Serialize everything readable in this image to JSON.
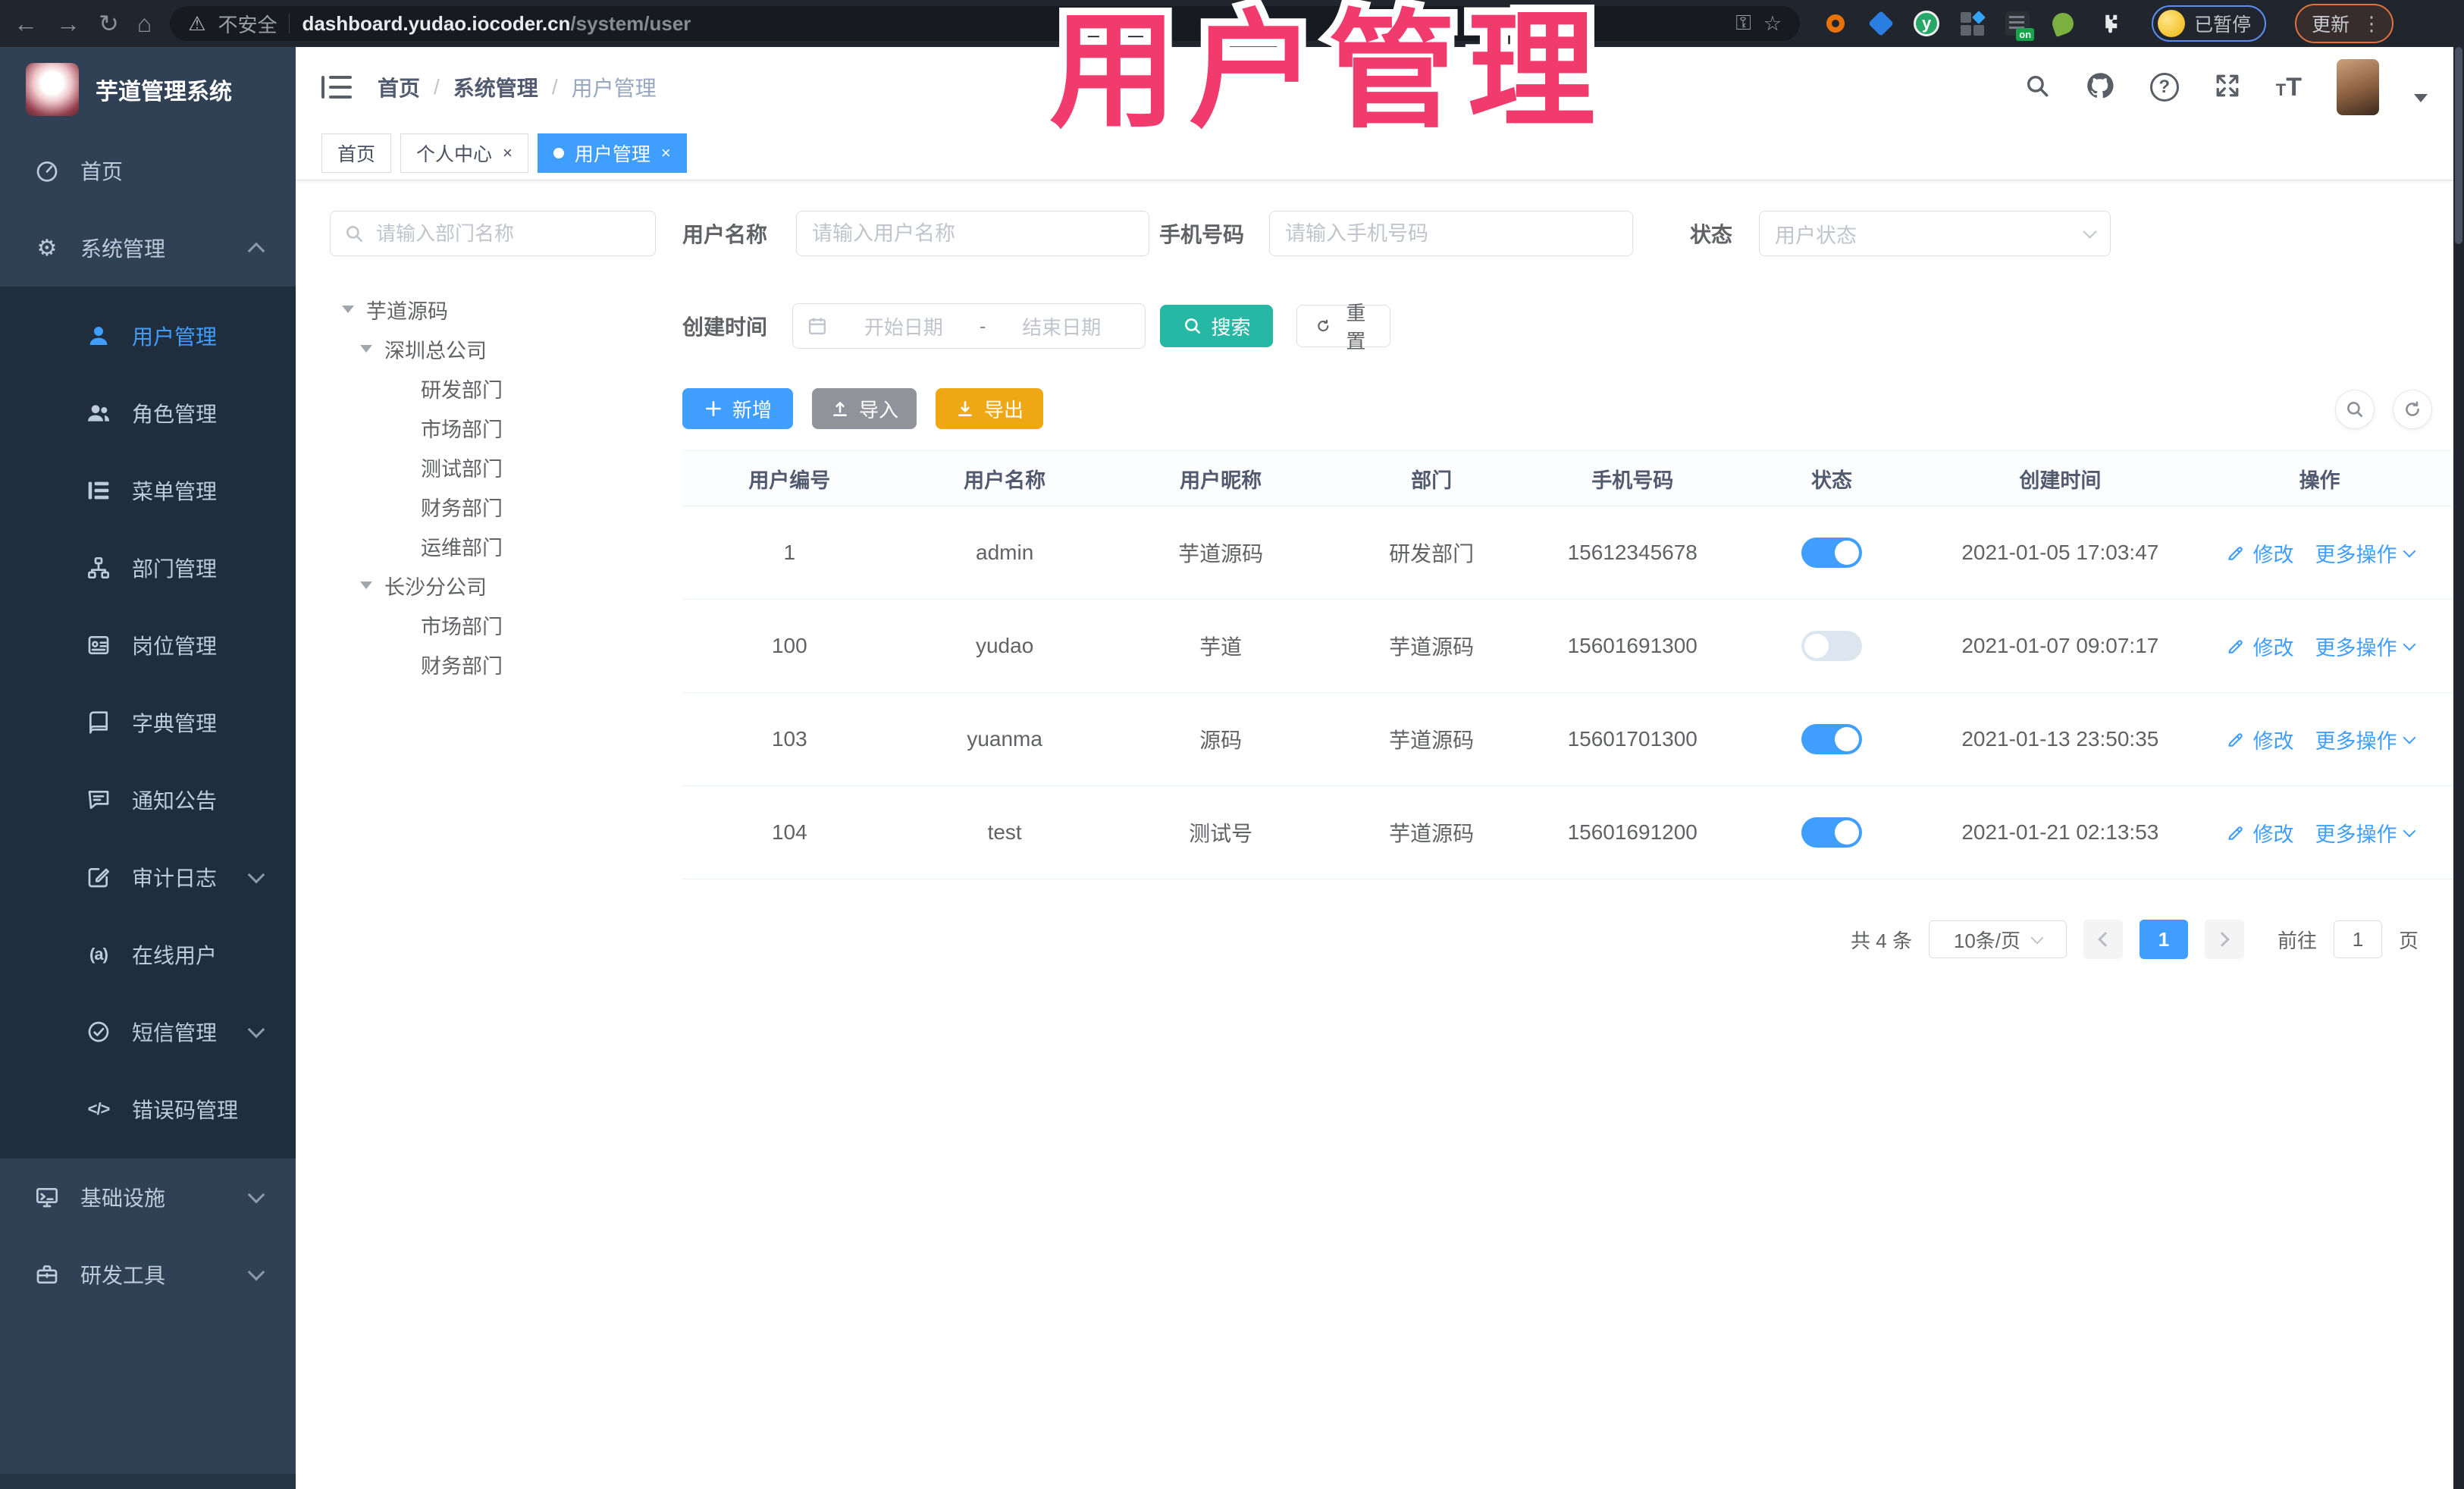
{
  "browser": {
    "security_label": "不安全",
    "url_host": "dashboard.yudao.iocoder.cn",
    "url_path": "/system/user",
    "profile_status": "已暂停",
    "update_label": "更新"
  },
  "overlay_title": "用户管理",
  "header": {
    "logo_title": "芋道管理系统",
    "breadcrumb": {
      "home": "首页",
      "section": "系统管理",
      "current": "用户管理"
    }
  },
  "tabs": [
    {
      "label": "首页"
    },
    {
      "label": "个人中心"
    },
    {
      "label": "用户管理"
    }
  ],
  "sidebar": {
    "items": [
      {
        "label": "首页",
        "icon": "dashboard-icon"
      },
      {
        "label": "系统管理",
        "icon": "gear-icon"
      },
      {
        "label": "用户管理",
        "icon": "user-icon"
      },
      {
        "label": "角色管理",
        "icon": "users-icon"
      },
      {
        "label": "菜单管理",
        "icon": "menu-list-icon"
      },
      {
        "label": "部门管理",
        "icon": "org-tree-icon"
      },
      {
        "label": "岗位管理",
        "icon": "id-badge-icon"
      },
      {
        "label": "字典管理",
        "icon": "book-icon"
      },
      {
        "label": "通知公告",
        "icon": "announcement-icon"
      },
      {
        "label": "审计日志",
        "icon": "audit-log-icon"
      },
      {
        "label": "在线用户",
        "icon": "online-user-icon"
      },
      {
        "label": "短信管理",
        "icon": "sms-icon"
      },
      {
        "label": "错误码管理",
        "icon": "error-code-icon"
      },
      {
        "label": "基础设施",
        "icon": "infrastructure-icon"
      },
      {
        "label": "研发工具",
        "icon": "dev-tools-icon"
      }
    ]
  },
  "dept_tree": {
    "search_placeholder": "请输入部门名称",
    "nodes": [
      {
        "label": "芋道源码"
      },
      {
        "label": "深圳总公司"
      },
      {
        "label": "研发部门"
      },
      {
        "label": "市场部门"
      },
      {
        "label": "测试部门"
      },
      {
        "label": "财务部门"
      },
      {
        "label": "运维部门"
      },
      {
        "label": "长沙分公司"
      },
      {
        "label": "市场部门"
      },
      {
        "label": "财务部门"
      }
    ]
  },
  "filters": {
    "username_label": "用户名称",
    "username_placeholder": "请输入用户名称",
    "mobile_label": "手机号码",
    "mobile_placeholder": "请输入手机号码",
    "status_label": "状态",
    "status_placeholder": "用户状态",
    "create_time_label": "创建时间",
    "date_start_placeholder": "开始日期",
    "date_separator": "-",
    "date_end_placeholder": "结束日期",
    "search_button": "搜索",
    "reset_button": "重置"
  },
  "toolbar": {
    "add": "新增",
    "import": "导入",
    "export": "导出"
  },
  "table": {
    "columns": [
      "用户编号",
      "用户名称",
      "用户昵称",
      "部门",
      "手机号码",
      "状态",
      "创建时间",
      "操作"
    ],
    "actions": {
      "edit": "修改",
      "more": "更多操作"
    },
    "rows": [
      {
        "id": "1",
        "username": "admin",
        "nickname": "芋道源码",
        "dept": "研发部门",
        "mobile": "15612345678",
        "status_on": true,
        "created": "2021-01-05 17:03:47"
      },
      {
        "id": "100",
        "username": "yudao",
        "nickname": "芋道",
        "dept": "芋道源码",
        "mobile": "15601691300",
        "status_on": false,
        "created": "2021-01-07 09:07:17"
      },
      {
        "id": "103",
        "username": "yuanma",
        "nickname": "源码",
        "dept": "芋道源码",
        "mobile": "15601701300",
        "status_on": true,
        "created": "2021-01-13 23:50:35"
      },
      {
        "id": "104",
        "username": "test",
        "nickname": "测试号",
        "dept": "芋道源码",
        "mobile": "15601691200",
        "status_on": true,
        "created": "2021-01-21 02:13:53"
      }
    ]
  },
  "pagination": {
    "total": "共 4 条",
    "page_size": "10条/页",
    "page": "1",
    "goto_label": "前往",
    "goto_value": "1",
    "unit": "页"
  },
  "colors": {
    "primary": "#409eff",
    "search_teal": "#26b8a5",
    "export_amber": "#f0a716",
    "import_grey": "#909399",
    "overlay_pink": "#f23b6d",
    "sidebar_bg": "#304156",
    "submenu_bg": "#1f2d3d"
  }
}
